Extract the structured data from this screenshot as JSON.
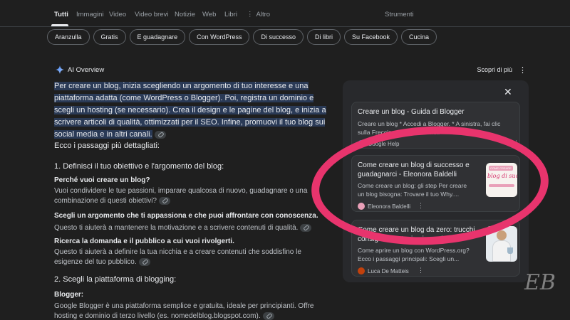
{
  "nav": {
    "tabs": [
      "Tutti",
      "Immagini",
      "Video",
      "Video brevi",
      "Notizie",
      "Web",
      "Libri"
    ],
    "more": "Altro",
    "tools": "Strumenti"
  },
  "chips": [
    "Aranzulla",
    "Gratis",
    "E guadagnare",
    "Con WordPress",
    "Di successo",
    "Di libri",
    "Su Facebook",
    "Cucina"
  ],
  "aio": {
    "title": "AI Overview",
    "more_link": "Scopri di più"
  },
  "content": {
    "intro": "Per creare un blog, inizia scegliendo un argomento di tuo interesse e una piattaforma adatta (come WordPress o Blogger). Poi, registra un dominio e scegli un hosting (se necessario). Crea il design e le pagine del blog, e inizia a scrivere articoli di qualità, ottimizzati per il SEO. Infine, promuovi il tuo blog sui social media e in altri canali.",
    "steps_intro": "Ecco i passaggi più dettagliati:",
    "step1_title": "1. Definisci il tuo obiettivo e l'argomento del blog:",
    "q1": "Perché vuoi creare un blog?",
    "q1_body_1": "Vuoi condividere le tue passioni, imparare qualcosa di nuovo, guadagnare o una",
    "q1_body_2": "combinazione di questi obiettivi?",
    "q2": "Scegli un argomento che ti appassiona e che puoi affrontare con conoscenza.",
    "q2_body": "Questo ti aiuterà a mantenere la motivazione e a scrivere contenuti di qualità.",
    "q3": "Ricerca la domanda e il pubblico a cui vuoi rivolgerti.",
    "q3_body_1": "Questo ti aiuterà a definire la tua nicchia e a creare contenuti che soddisfino le",
    "q3_body_2": "esigenze del tuo pubblico.",
    "step2_title": "2. Scegli la piattaforma di blogging:",
    "q4": "Blogger:",
    "q4_body_1": "Google Blogger è una piattaforma semplice e gratuita, ideale per principianti. Offre",
    "q4_body_2": "hosting e dominio di terzo livello (es. nomedelblog.blogspot.com)."
  },
  "sources": [
    {
      "title": "Creare un blog - Guida di Blogger",
      "snippet_1": "Creare un blog * Accedi a Blogger. * A sinistra, fai clic",
      "snippet_2": "sulla Freccia ... * Inserisci un...",
      "source": "Google Help",
      "fav_color": "#4285f4"
    },
    {
      "title": "Come creare un blog di successo e guadagnarci - Eleonora Baldelli",
      "snippet_1": "Come creare un blog: gli step Per creare",
      "snippet_2": "un blog bisogna: Trovare il tuo Why....",
      "source": "Eleonora Baldelli",
      "thumb_text": "blog di succe",
      "thumb_tag": "COME CREARE",
      "fav_color": "#e9a0b8"
    },
    {
      "title": "Come creare un blog da zero: trucchi, consigli e strategie vincenti",
      "snippet_1": "Come aprire un blog con WordPress.org?",
      "snippet_2": "Ecco i passaggi principali: Scegli un...",
      "source": "Luca De Matteis",
      "fav_color": "#c2410c"
    }
  ],
  "watermark": "EB",
  "colors": {
    "background": "#1f1f1f",
    "highlight": "#2a3a56",
    "annotation_circle": "#e8346d"
  }
}
